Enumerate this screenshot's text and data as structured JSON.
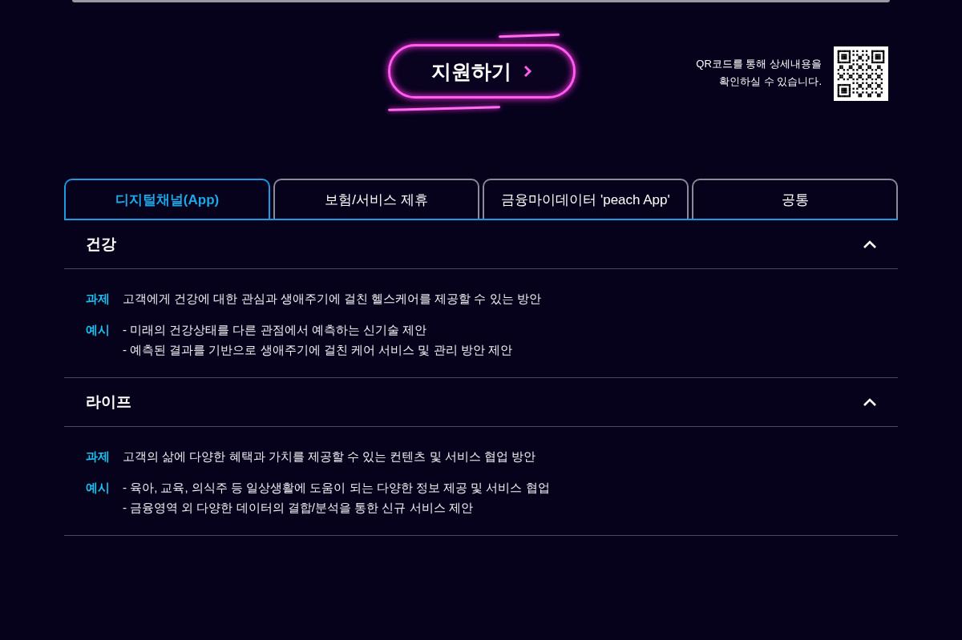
{
  "apply_button": {
    "label": "지원하기"
  },
  "qr_note": {
    "text": "QR코드를 통해 상세내용을\n확인하실 수 있습니다."
  },
  "tabs": [
    {
      "label": "디지털채널(App)",
      "selected": true
    },
    {
      "label": "보험/서비스 제휴",
      "selected": false
    },
    {
      "label": "금융마이데이터 'peach App'",
      "selected": false
    },
    {
      "label": "공통",
      "selected": false
    }
  ],
  "sections": [
    {
      "title": "건강",
      "expanded": true,
      "rows": [
        {
          "label": "과제",
          "lines": [
            "고객에게 건강에 대한 관심과 생애주기에 걸친 헬스케어를 제공할 수 있는 방안"
          ]
        },
        {
          "label": "예시",
          "lines": [
            "- 미래의 건강상태를 다른 관점에서 예측하는 신기술 제안",
            "- 예측된 결과를 기반으로 생애주기에 걸친 케어 서비스 및 관리 방안 제안"
          ]
        }
      ]
    },
    {
      "title": "라이프",
      "expanded": true,
      "rows": [
        {
          "label": "과제",
          "lines": [
            "고객의 삶에 다양한 혜택과 가치를 제공할 수 있는 컨텐츠 및 서비스 협업 방안"
          ]
        },
        {
          "label": "예시",
          "lines": [
            "- 육아, 교육, 의식주 등 일상생활에 도움이 되는 다양한 정보 제공 및 서비스 협업",
            "- 금융영역 외 다양한 데이터의 결합/분석을 통한 신규 서비스 제안"
          ]
        }
      ]
    }
  ]
}
